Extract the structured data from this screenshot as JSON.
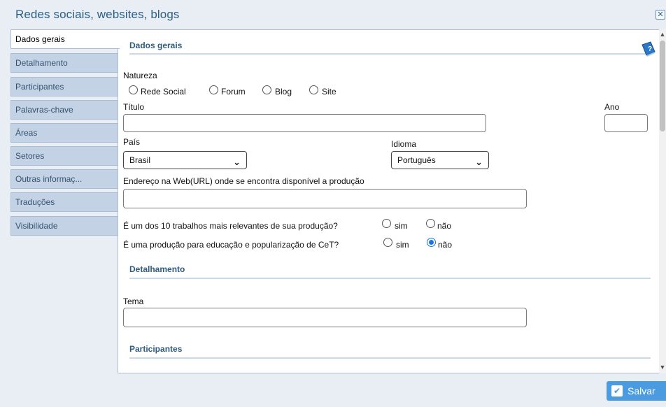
{
  "window": {
    "title": "Redes sociais, websites, blogs",
    "close_glyph": "✕"
  },
  "tabs": [
    {
      "label": "Dados gerais",
      "active": true
    },
    {
      "label": "Detalhamento",
      "active": false
    },
    {
      "label": "Participantes",
      "active": false
    },
    {
      "label": "Palavras-chave",
      "active": false
    },
    {
      "label": "Áreas",
      "active": false
    },
    {
      "label": "Setores",
      "active": false
    },
    {
      "label": "Outras informaç...",
      "active": false
    },
    {
      "label": "Traduções",
      "active": false
    },
    {
      "label": "Visibilidade",
      "active": false
    }
  ],
  "dados_gerais": {
    "heading": "Dados gerais",
    "natureza": {
      "label": "Natureza",
      "options": [
        "Rede Social",
        "Forum",
        "Blog",
        "Site"
      ],
      "selected": null
    },
    "titulo": {
      "label": "Título",
      "value": ""
    },
    "ano": {
      "label": "Ano",
      "value": ""
    },
    "pais": {
      "label": "País",
      "value": "Brasil"
    },
    "idioma": {
      "label": "Idioma",
      "value": "Português"
    },
    "url": {
      "label": "Endereço na Web(URL) onde se encontra disponível a produção",
      "value": ""
    },
    "relevantes": {
      "question": "É um dos 10 trabalhos mais relevantes de sua produção?",
      "yes": "sim",
      "no": "não",
      "selected": null
    },
    "educacao": {
      "question": "É uma produção para educação e popularização de CeT?",
      "yes": "sim",
      "no": "não",
      "selected": "não"
    }
  },
  "detalhamento": {
    "heading": "Detalhamento",
    "tema": {
      "label": "Tema",
      "value": ""
    }
  },
  "participantes": {
    "heading": "Participantes"
  },
  "footer": {
    "save_label": "Salvar"
  },
  "colors": {
    "accent": "#4b9be0",
    "heading": "#2f5b80",
    "tab_bg": "#c3d2e4"
  }
}
